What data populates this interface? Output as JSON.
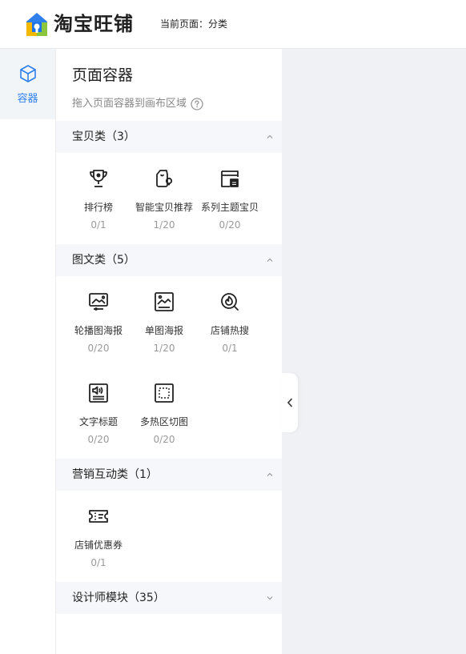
{
  "header": {
    "brand": "淘宝旺铺",
    "current_page": "当前页面：分类"
  },
  "rail": {
    "items": [
      {
        "label": "容器",
        "icon": "cube-icon",
        "active": true
      }
    ]
  },
  "panel": {
    "title": "页面容器",
    "hint": "拖入页面容器到画布区域",
    "categories": [
      {
        "label": "宝贝类（3）",
        "expanded": true,
        "items": [
          {
            "name": "排行榜",
            "count": "0/1",
            "icon": "trophy-icon"
          },
          {
            "name": "智能宝贝推荐",
            "count": "1/20",
            "icon": "smart-bag-icon"
          },
          {
            "name": "系列主题宝贝",
            "count": "0/20",
            "icon": "series-store-icon"
          }
        ]
      },
      {
        "label": "图文类（5）",
        "expanded": true,
        "items": [
          {
            "name": "轮播图海报",
            "count": "0/20",
            "icon": "carousel-icon"
          },
          {
            "name": "单图海报",
            "count": "1/20",
            "icon": "image-poster-icon"
          },
          {
            "name": "店铺热搜",
            "count": "0/1",
            "icon": "hot-search-icon"
          },
          {
            "name": "文字标题",
            "count": "0/20",
            "icon": "text-title-icon"
          },
          {
            "name": "多热区切图",
            "count": "0/20",
            "icon": "hotspot-icon"
          }
        ]
      },
      {
        "label": "营销互动类（1）",
        "expanded": true,
        "items": [
          {
            "name": "店铺优惠券",
            "count": "0/1",
            "icon": "coupon-icon"
          }
        ]
      },
      {
        "label": "设计师模块（35）",
        "expanded": false,
        "items": []
      }
    ]
  },
  "colors": {
    "accent": "#2f80ed",
    "category_bg": "#f5f7fa",
    "canvas_bg": "#f0f1f4"
  }
}
